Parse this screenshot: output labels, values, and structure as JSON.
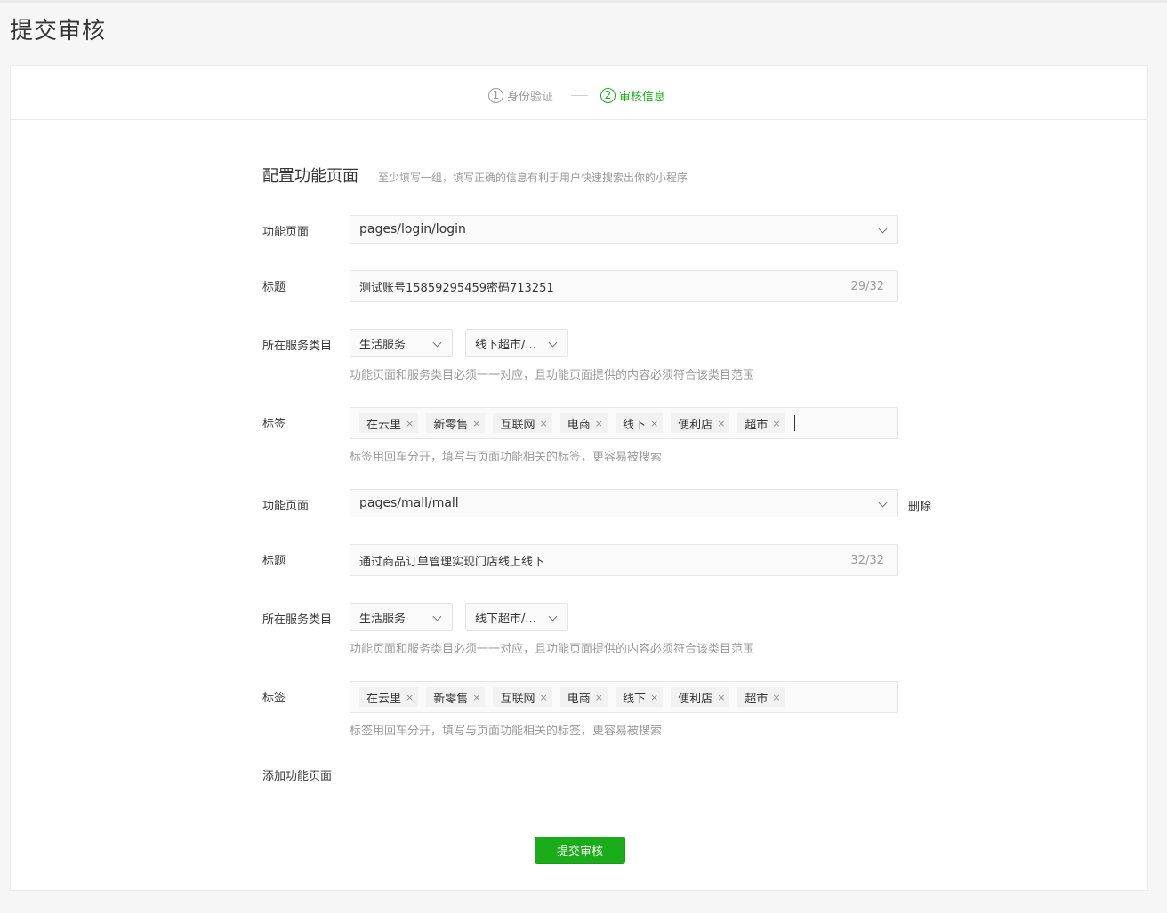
{
  "page": {
    "title": "提交审核"
  },
  "steps": [
    {
      "num": "1",
      "label": "身份验证"
    },
    {
      "num": "2",
      "label": "审核信息"
    }
  ],
  "section": {
    "title": "配置功能页面",
    "desc": "至少填写一组，填写正确的信息有利于用户快速搜索出你的小程序"
  },
  "labels": {
    "page": "功能页面",
    "title": "标题",
    "category": "所在服务类目",
    "tags": "标签"
  },
  "hints": {
    "category": "功能页面和服务类目必须一一对应，且功能页面提供的内容必须符合该类目范围",
    "tags": "标签用回车分开，填写与页面功能相关的标签，更容易被搜索"
  },
  "groups": [
    {
      "page_value": "pages/login/login",
      "title_value": "测试账号15859295459密码713251",
      "title_count": "29/32",
      "category1": "生活服务",
      "category2": "线下超市/...",
      "tags": [
        "在云里",
        "新零售",
        "互联网",
        "电商",
        "线下",
        "便利店",
        "超市"
      ]
    },
    {
      "page_value": "pages/mall/mall",
      "title_value": "通过商品订单管理实现门店线上线下",
      "title_count": "32/32",
      "category1": "生活服务",
      "category2": "线下超市/...",
      "tags": [
        "在云里",
        "新零售",
        "互联网",
        "电商",
        "线下",
        "便利店",
        "超市"
      ],
      "delete_label": "删除"
    }
  ],
  "tag_remove_glyph": "×",
  "add_page_label": "添加功能页面",
  "submit_label": "提交审核",
  "colors": {
    "accent": "#1aad19",
    "muted": "#9a9a9a",
    "text": "#353535"
  }
}
